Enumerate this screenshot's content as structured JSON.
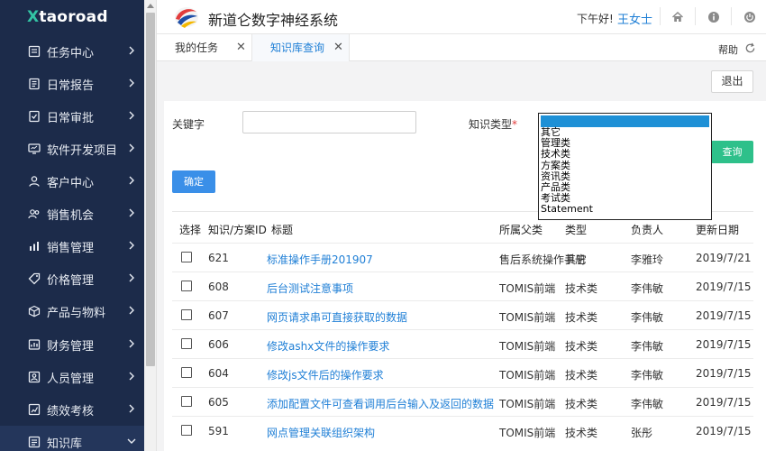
{
  "brand": {
    "x": "X",
    "rest": "taoroad"
  },
  "header": {
    "title": "新道仑数字神经系统",
    "greeting": "下午好!",
    "user": "王女士"
  },
  "sidebar": {
    "items": [
      {
        "label": "任务中心",
        "icon": "task-icon"
      },
      {
        "label": "日常报告",
        "icon": "report-icon"
      },
      {
        "label": "日常审批",
        "icon": "approval-icon"
      },
      {
        "label": "软件开发项目",
        "icon": "monitor-icon"
      },
      {
        "label": "客户中心",
        "icon": "customer-icon"
      },
      {
        "label": "销售机会",
        "icon": "opportunity-icon"
      },
      {
        "label": "销售管理",
        "icon": "sales-chart-icon"
      },
      {
        "label": "价格管理",
        "icon": "price-tag-icon"
      },
      {
        "label": "产品与物料",
        "icon": "box-icon"
      },
      {
        "label": "财务管理",
        "icon": "finance-icon"
      },
      {
        "label": "人员管理",
        "icon": "person-card-icon"
      },
      {
        "label": "绩效考核",
        "icon": "performance-icon"
      },
      {
        "label": "知识库",
        "icon": "knowledge-icon"
      }
    ]
  },
  "tabs": [
    {
      "label": "我的任务",
      "active": false
    },
    {
      "label": "知识库查询",
      "active": true
    }
  ],
  "help_label": "帮助",
  "exit_label": "退出",
  "filters": {
    "keyword_label": "关键字",
    "keyword_value": "",
    "type_label": "知识类型",
    "required_mark": "*",
    "type_options": [
      "其它",
      "管理类",
      "技术类",
      "方案类",
      "资讯类",
      "产品类",
      "考试类",
      "Statement"
    ],
    "confirm_label": "确定",
    "query_label": "查询"
  },
  "table": {
    "columns": [
      "选择",
      "知识/方案ID",
      "标题",
      "所属父类",
      "类型",
      "负责人",
      "更新日期"
    ],
    "rows": [
      {
        "id": "621",
        "title": "标准操作手册201907",
        "parent": "售后系统操作手册",
        "type": "其它",
        "owner": "李雅玲",
        "date": "2019/7/21"
      },
      {
        "id": "608",
        "title": "后台测试注意事项",
        "parent": "TOMIS前端",
        "type": "技术类",
        "owner": "李伟敏",
        "date": "2019/7/15"
      },
      {
        "id": "607",
        "title": "网页请求串可直接获取的数据",
        "parent": "TOMIS前端",
        "type": "技术类",
        "owner": "李伟敏",
        "date": "2019/7/15"
      },
      {
        "id": "606",
        "title": "修改ashx文件的操作要求",
        "parent": "TOMIS前端",
        "type": "技术类",
        "owner": "李伟敏",
        "date": "2019/7/15"
      },
      {
        "id": "604",
        "title": "修改js文件后的操作要求",
        "parent": "TOMIS前端",
        "type": "技术类",
        "owner": "李伟敏",
        "date": "2019/7/15"
      },
      {
        "id": "605",
        "title": "添加配置文件可查看调用后台输入及返回的数据",
        "parent": "TOMIS前端",
        "type": "技术类",
        "owner": "李伟敏",
        "date": "2019/7/15"
      },
      {
        "id": "591",
        "title": "网点管理关联组织架构",
        "parent": "TOMIS前端",
        "type": "技术类",
        "owner": "张彤",
        "date": "2019/7/15"
      }
    ]
  },
  "colors": {
    "sidebar": "#1c2b4a",
    "accent": "#1f7fd6",
    "query": "#2ec08a",
    "brand_x": "#33c4a5"
  }
}
